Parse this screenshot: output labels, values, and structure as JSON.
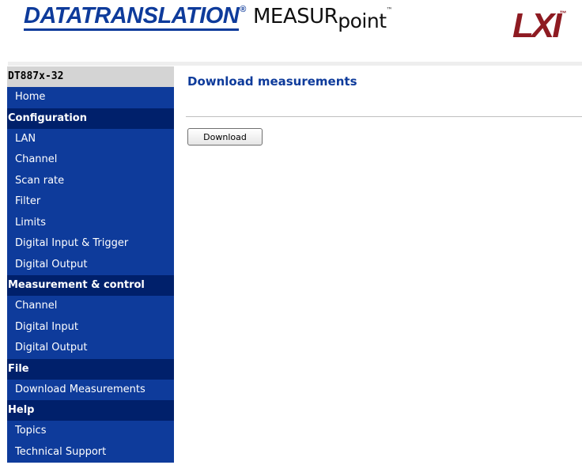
{
  "header": {
    "brand_logo": "DATATRANSLATION",
    "brand_reg": "®",
    "product_logo_a": "MEASUR",
    "product_logo_b": "point",
    "product_tm": "™",
    "lxi_logo": "LXI",
    "lxi_tm": "™"
  },
  "sidebar": {
    "device": "DT887x-32",
    "home": "Home",
    "sections": [
      {
        "label": "Configuration",
        "items": [
          "LAN",
          "Channel",
          "Scan rate",
          "Filter",
          "Limits",
          "Digital Input & Trigger",
          "Digital Output"
        ]
      },
      {
        "label": "Measurement & control",
        "items": [
          "Channel",
          "Digital Input",
          "Digital Output"
        ]
      },
      {
        "label": "File",
        "items": [
          "Download Measurements"
        ]
      },
      {
        "label": "Help",
        "items": [
          "Topics",
          "Technical Support"
        ]
      }
    ]
  },
  "main": {
    "title": "Download measurements",
    "download_button": "Download"
  },
  "colors": {
    "nav_item_bg": "#0e3b9b",
    "nav_section_bg": "#00206b",
    "title_color": "#0e3b9b",
    "lxi_color": "#8e1b22"
  }
}
